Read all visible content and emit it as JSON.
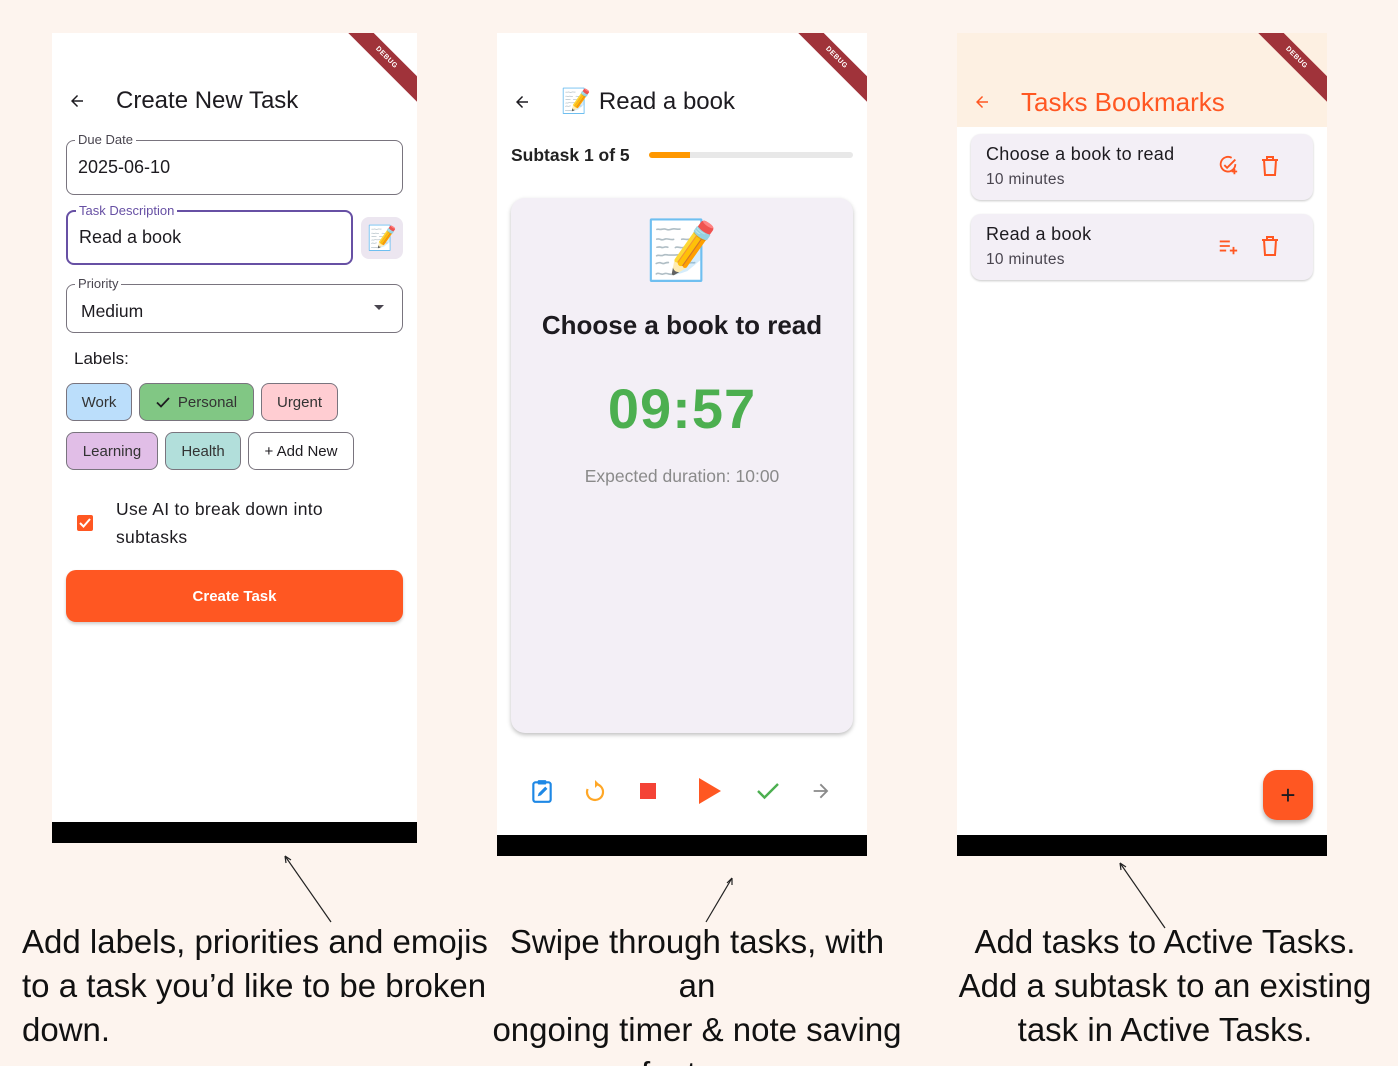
{
  "screen1": {
    "debug": "DEBUG",
    "title": "Create New Task",
    "due_date": {
      "label": "Due Date",
      "value": "2025-06-10"
    },
    "description": {
      "label": "Task Description",
      "value": "Read a book",
      "emoji": "📝"
    },
    "priority": {
      "label": "Priority",
      "value": "Medium"
    },
    "labels_heading": "Labels:",
    "chips": [
      {
        "label": "Work",
        "color": "#bbdefb",
        "selected": false
      },
      {
        "label": "Personal",
        "color": "#81c784",
        "selected": true
      },
      {
        "label": "Urgent",
        "color": "#ffcdd2",
        "selected": false
      },
      {
        "label": "Learning",
        "color": "#e1bee7",
        "selected": false
      },
      {
        "label": "Health",
        "color": "#b2dfdb",
        "selected": false
      },
      {
        "label": "+ Add New",
        "color": "#ffffff",
        "selected": false
      }
    ],
    "ai_checkbox": {
      "checked": true,
      "label": "Use AI to break down into subtasks"
    },
    "create_button": "Create Task"
  },
  "screen2": {
    "debug": "DEBUG",
    "title_emoji": "📝",
    "title": "Read a book",
    "subtask_label": "Subtask 1 of 5",
    "progress_fraction": 0.2,
    "card_emoji": "📝",
    "card_title": "Choose a book to read",
    "timer": "09:57",
    "expected": "Expected duration: 10:00",
    "controls": [
      "edit-note-icon",
      "restart-icon",
      "stop-icon",
      "play-icon",
      "check-icon",
      "arrow-forward-icon"
    ]
  },
  "screen3": {
    "debug": "DEBUG",
    "title": "Tasks Bookmarks",
    "items": [
      {
        "title": "Choose a book to read",
        "subtitle": "10 minutes",
        "action_icon": "add-task-icon"
      },
      {
        "title": "Read a book",
        "subtitle": "10 minutes",
        "action_icon": "playlist-add-icon"
      }
    ],
    "fab": "+"
  },
  "captions": {
    "c1": [
      "Add labels, priorities and emojis",
      "to a task you’d like to be broken",
      "down."
    ],
    "c2": [
      "Swipe through tasks, with an",
      "ongoing timer & note saving",
      "feature."
    ],
    "c3": [
      "Add tasks to Active Tasks.",
      "Add a subtask to an existing",
      "task in Active Tasks."
    ]
  },
  "colors": {
    "accent": "#ff5722",
    "timer": "#4caf50",
    "progress": "#ff9800",
    "focus": "#6750a4",
    "background": "#fdf4ee"
  }
}
